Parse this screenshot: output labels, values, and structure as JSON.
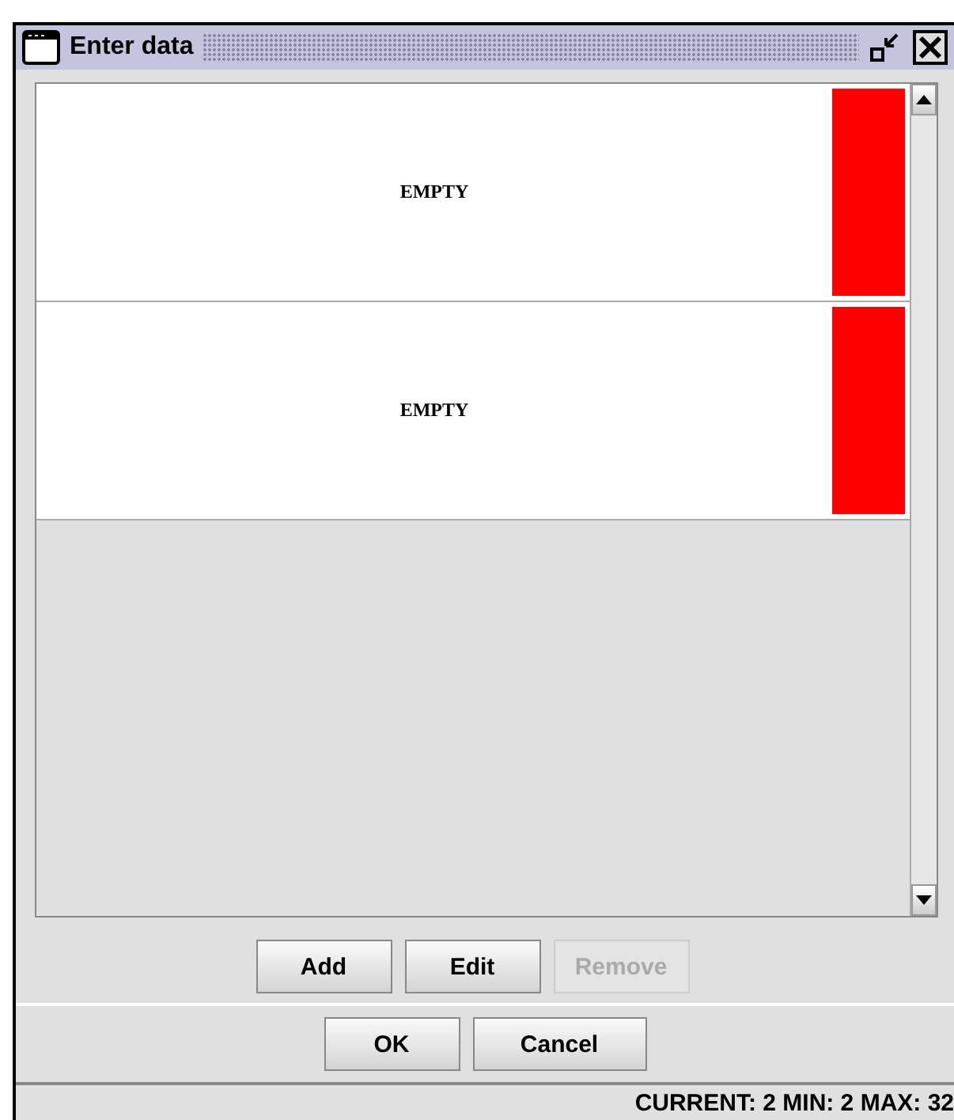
{
  "window": {
    "title": "Enter data"
  },
  "rows": [
    {
      "text": "EMPTY",
      "color": "#ff0000"
    },
    {
      "text": "EMPTY",
      "color": "#ff0000"
    }
  ],
  "list_buttons": [
    {
      "label": "Add",
      "disabled": false
    },
    {
      "label": "Edit",
      "disabled": false
    },
    {
      "label": "Remove",
      "disabled": true
    }
  ],
  "dialog_buttons": [
    {
      "label": "OK"
    },
    {
      "label": "Cancel"
    }
  ],
  "status_bar": "CURRENT: 2 MIN: 2 MAX: 32"
}
